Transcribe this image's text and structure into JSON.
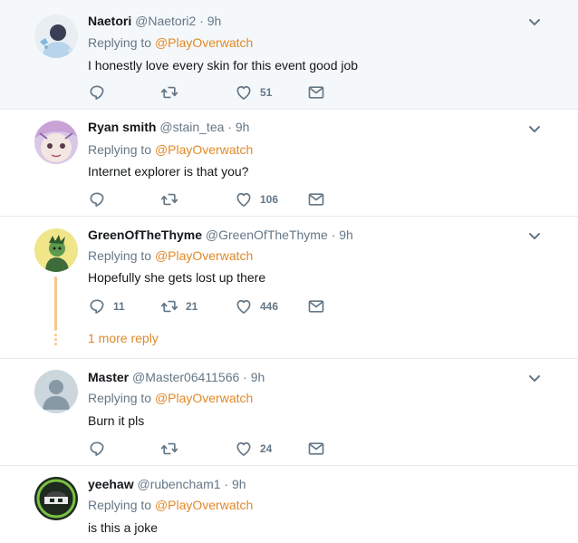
{
  "tweets": [
    {
      "name": "Naetori",
      "handle": "@Naetori2",
      "sep": "·",
      "time": "9h",
      "replying_label": "Replying to",
      "replying_to": "@PlayOverwatch",
      "text": "I honestly love every skin for this event good job",
      "replies": "",
      "retweets": "",
      "likes": "51"
    },
    {
      "name": "Ryan smith",
      "handle": "@stain_tea",
      "sep": "·",
      "time": "9h",
      "replying_label": "Replying to",
      "replying_to": "@PlayOverwatch",
      "text": "Internet explorer is that you?",
      "replies": "",
      "retweets": "",
      "likes": "106"
    },
    {
      "name": "GreenOfTheThyme",
      "handle": "@GreenOfTheThyme",
      "sep": "·",
      "time": "9h",
      "replying_label": "Replying to",
      "replying_to": "@PlayOverwatch",
      "text": "Hopefully she gets lost up there",
      "replies": "11",
      "retweets": "21",
      "likes": "446",
      "more_replies": "1 more reply"
    },
    {
      "name": "Master",
      "handle": "@Master06411566",
      "sep": "·",
      "time": "9h",
      "replying_label": "Replying to",
      "replying_to": "@PlayOverwatch",
      "text": "Burn it pls",
      "replies": "",
      "retweets": "",
      "likes": "24"
    },
    {
      "name": "yeehaw",
      "handle": "@rubencham1",
      "sep": "·",
      "time": "9h",
      "replying_label": "Replying to",
      "replying_to": "@PlayOverwatch",
      "text": "is this a joke"
    }
  ],
  "colors": {
    "accent": "#e0892a",
    "muted": "#657786",
    "thread": "#f7c886",
    "highlight_bg": "#f5f8fa",
    "divider": "#e6ecf0"
  },
  "icons": [
    "reply-icon",
    "retweet-icon",
    "like-icon",
    "direct-message-icon",
    "chevron-down-icon"
  ]
}
